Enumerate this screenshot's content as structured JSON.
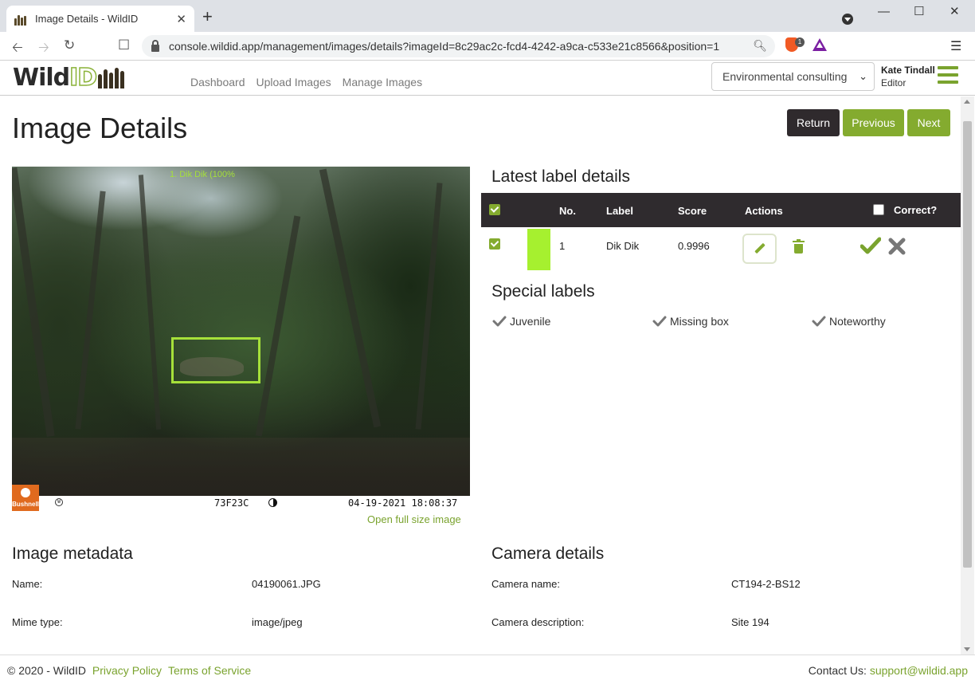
{
  "browser": {
    "tab_title": "Image Details - WildID",
    "url": "console.wildid.app/management/images/details?imageId=8c29ac2c-fcd4-4242-a9ca-c533e21c8566&position=1",
    "brave_badge": "1"
  },
  "header": {
    "logo_text_1": "Wild",
    "logo_text_2": "ID",
    "nav": [
      "Dashboard",
      "Upload Images",
      "Manage Images"
    ],
    "organisation": "Environmental consulting",
    "user_name": "Kate Tindall",
    "user_role": "Editor"
  },
  "page": {
    "title": "Image Details",
    "buttons": {
      "return": "Return",
      "previous": "Previous",
      "next": "Next"
    }
  },
  "image": {
    "detection_label": "1. Dik Dik (100%",
    "camera_id": "73F23C",
    "timestamp": "04-19-2021 18:08:37",
    "brand": "Bushnell",
    "open_full_size": "Open full size image"
  },
  "labels": {
    "heading": "Latest label details",
    "columns": {
      "no": "No.",
      "label": "Label",
      "score": "Score",
      "actions": "Actions",
      "correct": "Correct?"
    },
    "rows": [
      {
        "no": "1",
        "label": "Dik Dik",
        "score": "0.9996",
        "color": "#a6f02f"
      }
    ]
  },
  "special_labels": {
    "heading": "Special labels",
    "items": [
      "Juvenile",
      "Missing box",
      "Noteworthy"
    ]
  },
  "metadata": {
    "heading": "Image metadata",
    "rows": [
      {
        "key": "Name:",
        "value": "04190061.JPG"
      },
      {
        "key": "Mime type:",
        "value": "image/jpeg"
      }
    ]
  },
  "camera": {
    "heading": "Camera details",
    "rows": [
      {
        "key": "Camera name:",
        "value": "CT194-2-BS12"
      },
      {
        "key": "Camera description:",
        "value": "Site 194"
      }
    ]
  },
  "footer": {
    "copyright": "© 2020 - WildID",
    "privacy": "Privacy Policy",
    "terms": "Terms of Service",
    "contact_label": "Contact Us:",
    "contact_email": "support@wildid.app"
  },
  "colors": {
    "accent": "#84ab2f",
    "dark": "#2f2b2e",
    "bbox": "#a6e03a"
  }
}
